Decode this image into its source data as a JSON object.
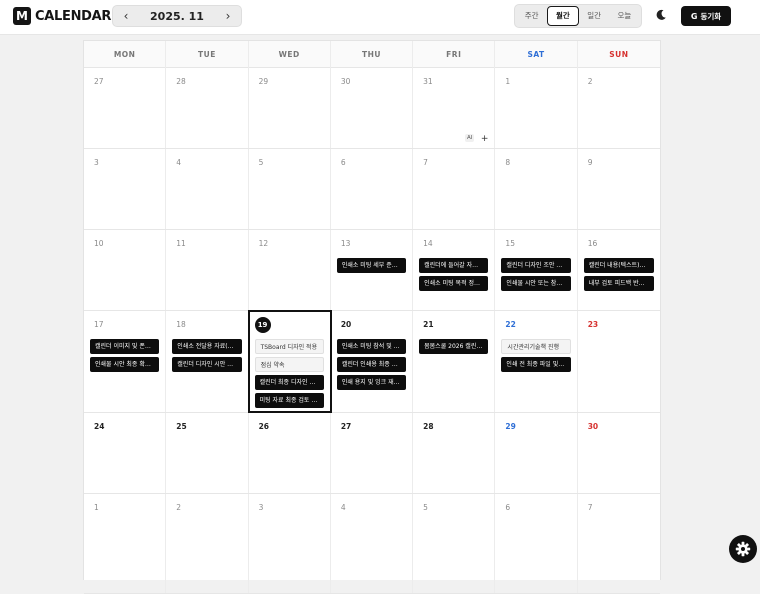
{
  "app": {
    "logo_letter": "M",
    "name": "CALENDAR"
  },
  "month_nav": {
    "prev_icon": "chevron-left-icon",
    "label": "2025. 11",
    "next_icon": "chevron-right-icon"
  },
  "view_toggle": {
    "items": [
      "주간",
      "월간",
      "일간",
      "오늘"
    ],
    "active": "월간"
  },
  "theme_toggle": {
    "icon": "moon-icon"
  },
  "sync_button": {
    "icon_text": "G",
    "label": "동기화"
  },
  "weekdays": [
    "MON",
    "TUE",
    "WED",
    "THU",
    "FRI",
    "SAT",
    "SUN"
  ],
  "colors": {
    "accent": "#111111",
    "saturday": "#2f6fd6",
    "sunday": "#d6312f"
  },
  "weeks": [
    {
      "days": [
        {
          "num": "27",
          "state": "other"
        },
        {
          "num": "28",
          "state": "other"
        },
        {
          "num": "29",
          "state": "other"
        },
        {
          "num": "30",
          "state": "other"
        },
        {
          "num": "31",
          "state": "other",
          "ai_label": "AI",
          "add_label": "+"
        },
        {
          "num": "1",
          "state": "muted"
        },
        {
          "num": "2",
          "state": "muted"
        }
      ]
    },
    {
      "days": [
        {
          "num": "3",
          "state": "muted"
        },
        {
          "num": "4",
          "state": "muted"
        },
        {
          "num": "5",
          "state": "muted"
        },
        {
          "num": "6",
          "state": "muted"
        },
        {
          "num": "7",
          "state": "muted"
        },
        {
          "num": "8",
          "state": "muted"
        },
        {
          "num": "9",
          "state": "muted"
        }
      ]
    },
    {
      "days": [
        {
          "num": "10",
          "state": "muted"
        },
        {
          "num": "11",
          "state": "muted"
        },
        {
          "num": "12",
          "state": "muted"
        },
        {
          "num": "13",
          "state": "muted",
          "events": [
            {
              "text": "인쇄소 미팅 세부 준…",
              "style": "dark"
            }
          ]
        },
        {
          "num": "14",
          "state": "muted",
          "events": [
            {
              "text": "캘린더에 들어갈 자…",
              "style": "dark"
            },
            {
              "text": "인쇄소 미팅 목적 정…",
              "style": "dark"
            }
          ]
        },
        {
          "num": "15",
          "state": "muted",
          "events": [
            {
              "text": "캘린더 디자인 조안 …",
              "style": "dark"
            },
            {
              "text": "인쇄물 시안 또는 참…",
              "style": "dark"
            }
          ]
        },
        {
          "num": "16",
          "state": "muted",
          "events": [
            {
              "text": "캘린더 내용(텍스트)…",
              "style": "dark"
            },
            {
              "text": "내부 검토 피드백 반…",
              "style": "dark"
            }
          ]
        }
      ]
    },
    {
      "days": [
        {
          "num": "17",
          "state": "muted",
          "events": [
            {
              "text": "캘린더 이미지 및 폰…",
              "style": "dark"
            },
            {
              "text": "인쇄물 시안 최종 확…",
              "style": "dark"
            }
          ]
        },
        {
          "num": "18",
          "state": "muted",
          "events": [
            {
              "text": "인쇄소 전달용 자료(…",
              "style": "dark"
            },
            {
              "text": "캘린더 디자인 시안 …",
              "style": "dark"
            }
          ]
        },
        {
          "num": "19",
          "state": "today",
          "events": [
            {
              "text": "TSBoard 디자인 적용",
              "style": "light"
            },
            {
              "text": "점심 약속",
              "style": "light"
            },
            {
              "text": "캘린더 최종 디자인 …",
              "style": "dark"
            },
            {
              "text": "미팅 자료 최종 검토 …",
              "style": "dark"
            }
          ]
        },
        {
          "num": "20",
          "state": "current",
          "events": [
            {
              "text": "인쇄소 미팅 참석 및 …",
              "style": "dark"
            },
            {
              "text": "캘린더 인쇄용 최종 …",
              "style": "dark"
            },
            {
              "text": "인쇄 용지 및 잉크 재…",
              "style": "dark"
            }
          ]
        },
        {
          "num": "21",
          "state": "current",
          "events": [
            {
              "text": "봄봄스쿨 2026 캘린…",
              "style": "dark"
            }
          ]
        },
        {
          "num": "22",
          "state": "sat",
          "events": [
            {
              "text": "시간관리기술책 진행",
              "style": "light"
            },
            {
              "text": "인쇄 전 최종 파일 및…",
              "style": "dark"
            }
          ]
        },
        {
          "num": "23",
          "state": "sun"
        }
      ]
    },
    {
      "days": [
        {
          "num": "24",
          "state": "current"
        },
        {
          "num": "25",
          "state": "current"
        },
        {
          "num": "26",
          "state": "current"
        },
        {
          "num": "27",
          "state": "current"
        },
        {
          "num": "28",
          "state": "current"
        },
        {
          "num": "29",
          "state": "sat"
        },
        {
          "num": "30",
          "state": "sun"
        }
      ]
    },
    {
      "days": [
        {
          "num": "1",
          "state": "other"
        },
        {
          "num": "2",
          "state": "other"
        },
        {
          "num": "3",
          "state": "other"
        },
        {
          "num": "4",
          "state": "other"
        },
        {
          "num": "5",
          "state": "other"
        },
        {
          "num": "6",
          "state": "other"
        },
        {
          "num": "7",
          "state": "other"
        }
      ]
    }
  ],
  "settings_fab": {
    "icon": "gear-icon"
  }
}
